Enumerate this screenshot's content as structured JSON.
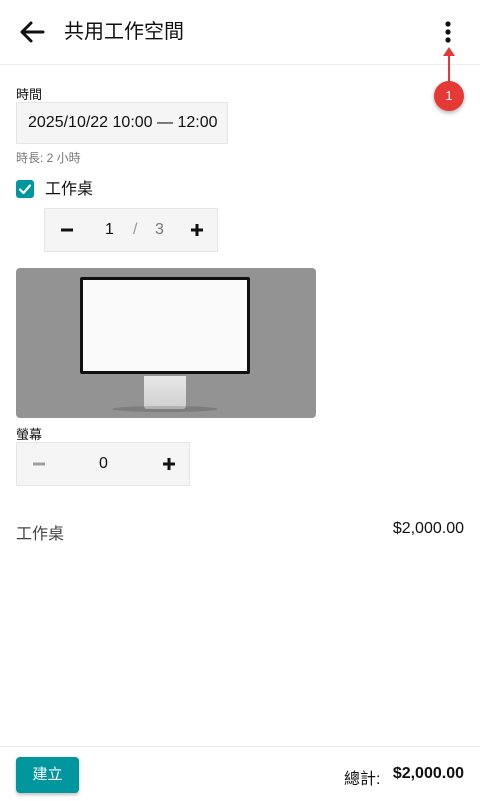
{
  "appbar": {
    "title": "共用工作空間",
    "back_icon": "arrow-left-icon",
    "more_icon": "more-vert-icon"
  },
  "callout": {
    "label": "1",
    "color": "#e53935"
  },
  "time": {
    "label": "時間",
    "value": "2025/10/22 10:00 — 12:00",
    "duration": "時長: 2 小時"
  },
  "desk": {
    "checked": true,
    "label": "工作桌",
    "quantity": "1",
    "separator": "/",
    "max": "3",
    "decrement_icon": "minus-icon",
    "increment_icon": "plus-icon"
  },
  "monitor": {
    "image_icon": "monitor-image",
    "label": "螢幕",
    "quantity": "0",
    "decrement_icon": "minus-icon",
    "increment_icon": "plus-icon"
  },
  "summary": {
    "items": [
      {
        "name": "工作桌",
        "price": "$2,000.00"
      }
    ]
  },
  "footer": {
    "create_label": "建立",
    "total_label": "總計:",
    "total_value": "$2,000.00"
  },
  "colors": {
    "accent": "#00969e",
    "callout": "#e53935"
  }
}
